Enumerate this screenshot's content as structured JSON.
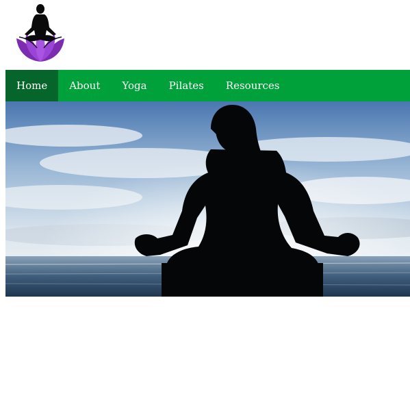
{
  "logo": {
    "icon": "lotus-meditation-icon",
    "colors": {
      "figure": "#0a0a0a",
      "lotus": "#8b34c4",
      "lotus_dark": "#5b1a8a"
    }
  },
  "nav": {
    "active_color": "#05652a",
    "bar_color": "#00a03a",
    "items": [
      {
        "label": "Home",
        "active": true
      },
      {
        "label": "About",
        "active": false
      },
      {
        "label": "Yoga",
        "active": false
      },
      {
        "label": "Pilates",
        "active": false
      },
      {
        "label": "Resources",
        "active": false
      }
    ]
  },
  "hero": {
    "subject": "meditation-silhouette-icon"
  }
}
